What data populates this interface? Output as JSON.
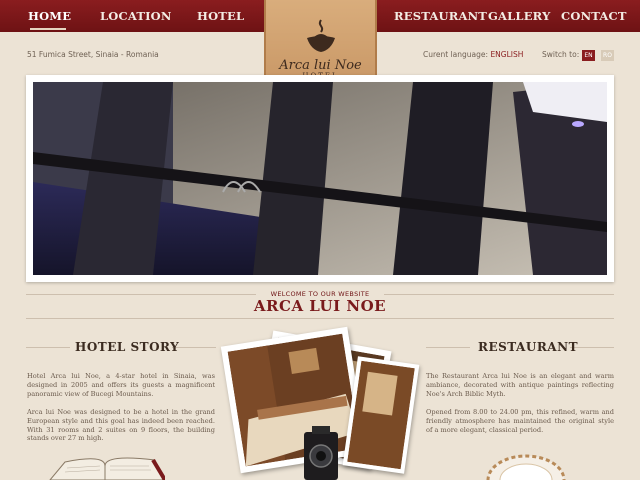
{
  "nav": {
    "items": [
      "HOME",
      "LOCATION",
      "HOTEL",
      "RESTAURANT",
      "GALLERY",
      "CONTACT"
    ],
    "active": "HOME"
  },
  "logo": {
    "name": "Arca lui Noe",
    "sub": "HOTEL",
    "stars": "★★★★"
  },
  "header": {
    "address": "51 Fumica Street, Sinaia - Romania",
    "language_label": "Curent language:",
    "language_value": "ENGLISH",
    "switch_label": "Switch to:",
    "flags": [
      "EN",
      "RO"
    ]
  },
  "welcome": {
    "kicker": "WELCOME TO OUR WEBSITE",
    "title": "ARCA LUI NOE"
  },
  "hotel_story": {
    "title": "HOTEL STORY",
    "p1": "Hotel Arca lui Noe, a 4-star hotel in Sinaia, was designed in 2005 and offers its guests a magnificent panoramic view of Bucegi Mountains.",
    "p2": "Arca lui Noe was designed to be a hotel in the grand European style and this goal has indeed been reached. With 31 rooms and 2 suites on 9 floors, the building stands over 27 m high."
  },
  "restaurant": {
    "title": "RESTAURANT",
    "p1": "The Restaurant Arca lui Noe is an elegant and warm ambiance, decorated with antique paintings reflecting Noe's Arch Biblic Myth.",
    "p2": "Opened from 8.00 to 24.00 pm, this refined, warm and friendly atmosphere has maintained the original style of a more elegant, classical period."
  },
  "colors": {
    "brand": "#7a1a1c",
    "bar": "#6e1214",
    "ribbon": "#c89a6c",
    "background": "#ece3d5"
  },
  "icons": [
    "ark-logo-icon",
    "book-icon",
    "camera-icon",
    "plate-icon"
  ]
}
